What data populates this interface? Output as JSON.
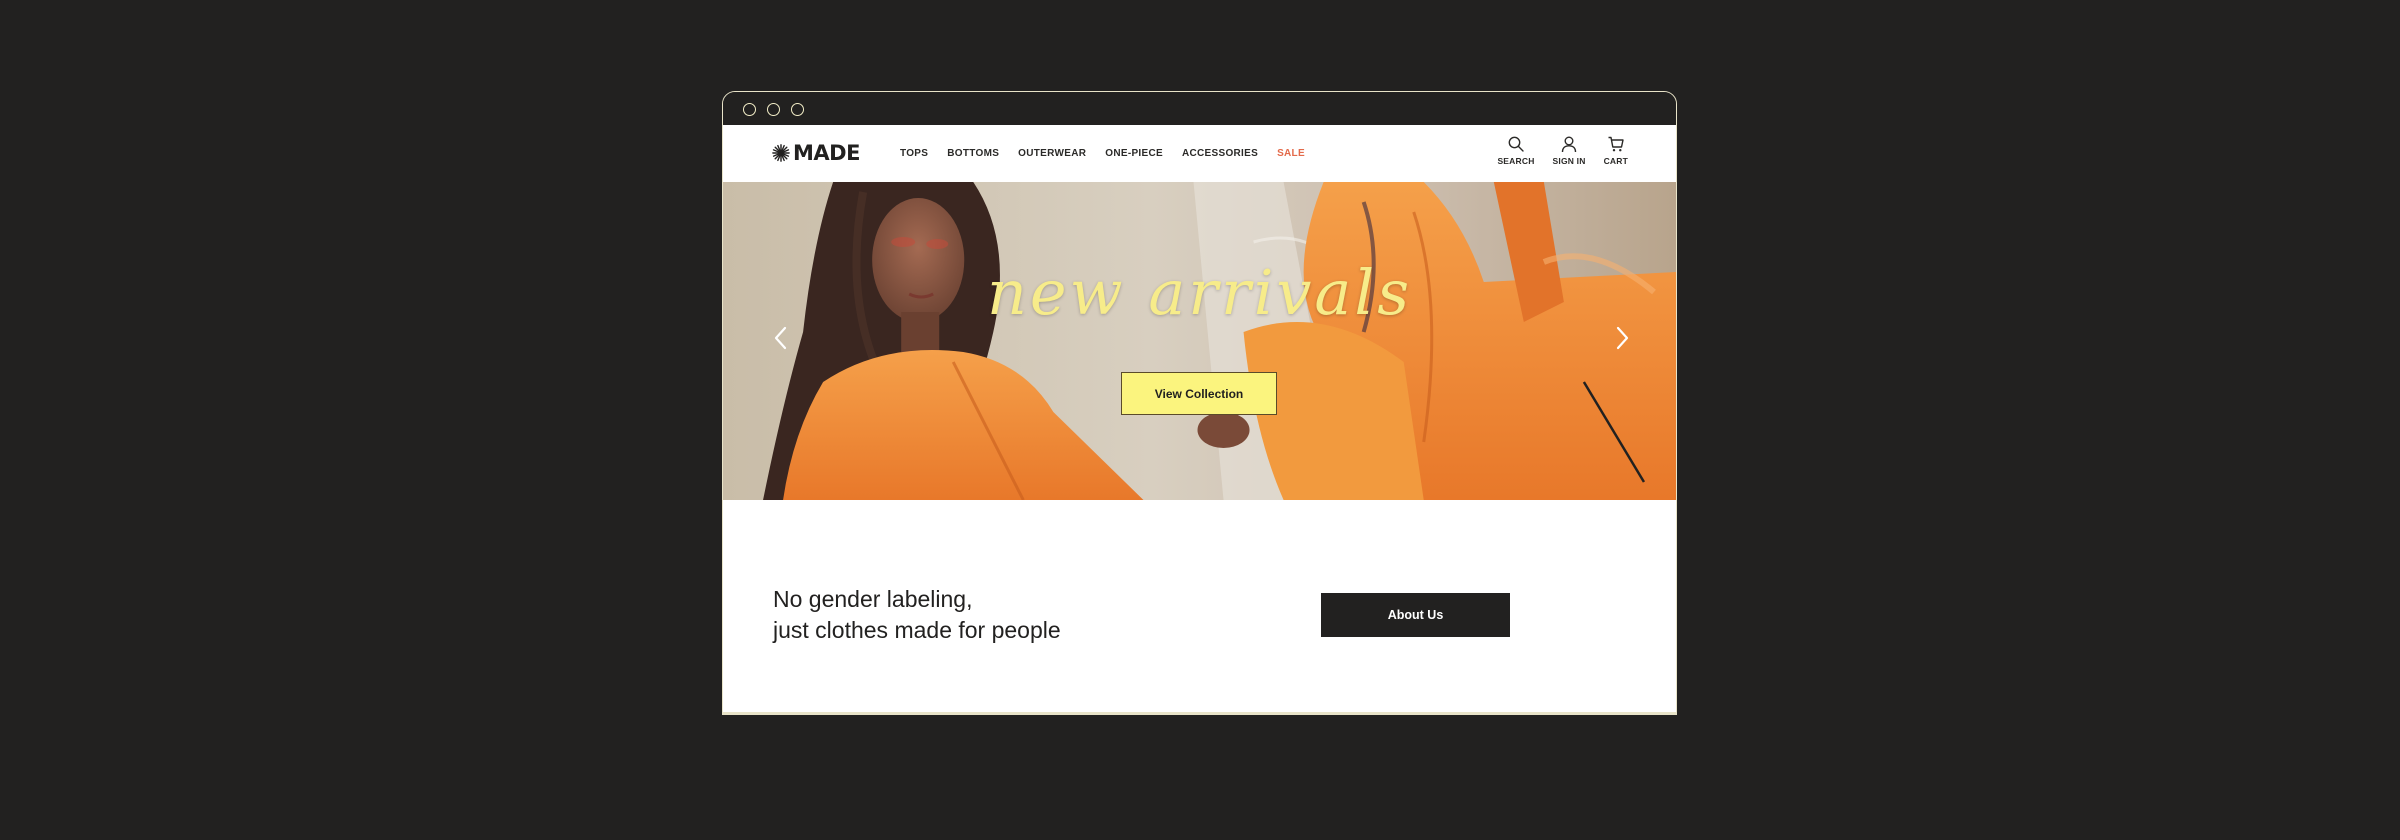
{
  "brand": {
    "name": "MADE",
    "logo_icon": "asterisk-star-icon"
  },
  "nav": {
    "items": [
      {
        "label": "TOPS"
      },
      {
        "label": "BOTTOMS"
      },
      {
        "label": "OUTERWEAR"
      },
      {
        "label": "ONE-PIECE"
      },
      {
        "label": "ACCESSORIES"
      },
      {
        "label": "SALE"
      }
    ]
  },
  "utilities": {
    "search": {
      "label": "SEARCH",
      "icon": "search-icon"
    },
    "signin": {
      "label": "SIGN IN",
      "icon": "user-icon"
    },
    "cart": {
      "label": "CART",
      "icon": "cart-icon"
    }
  },
  "hero": {
    "title": "new arrivals",
    "button_label": "View Collection",
    "prev_icon": "chevron-left-icon",
    "next_icon": "chevron-right-icon"
  },
  "about": {
    "tagline_line1": "No gender labeling,",
    "tagline_line2": "just clothes made for people",
    "button_label": "About Us"
  },
  "colors": {
    "background": "#222120",
    "accent_yellow": "#fbf47e",
    "sale": "#e36a4a",
    "orange": "#f08a2a"
  }
}
